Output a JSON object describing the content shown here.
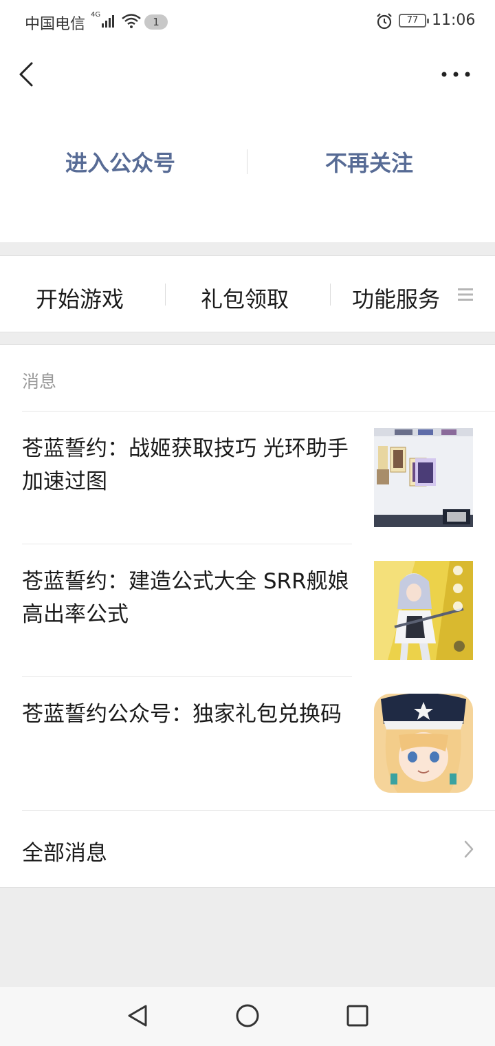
{
  "status_bar": {
    "carrier": "中国电信",
    "network": "4G",
    "notification_count": "1",
    "battery": "77",
    "time": "11:06"
  },
  "header": {
    "back_icon": "back-arrow-icon",
    "more_icon": "more-dots-icon",
    "enter_account_label": "进入公众号",
    "unfollow_label": "不再关注"
  },
  "menu": {
    "items": [
      {
        "label": "开始游戏"
      },
      {
        "label": "礼包领取"
      },
      {
        "label": "功能服务"
      }
    ],
    "menu_icon": "hamburger-icon"
  },
  "messages": {
    "section_title": "消息",
    "articles": [
      {
        "title": "苍蓝誓约：战姬获取技巧 光环助手加速过图"
      },
      {
        "title": "苍蓝誓约：建造公式大全 SRR舰娘高出率公式"
      },
      {
        "title": "苍蓝誓约公众号：独家礼包兑换码"
      }
    ],
    "all_label": "全部消息"
  },
  "nav_bar": {
    "back_icon": "nav-back-triangle-icon",
    "home_icon": "nav-home-circle-icon",
    "recent_icon": "nav-recent-square-icon"
  },
  "colors": {
    "link_blue": "#576b95",
    "background": "#ededed"
  }
}
